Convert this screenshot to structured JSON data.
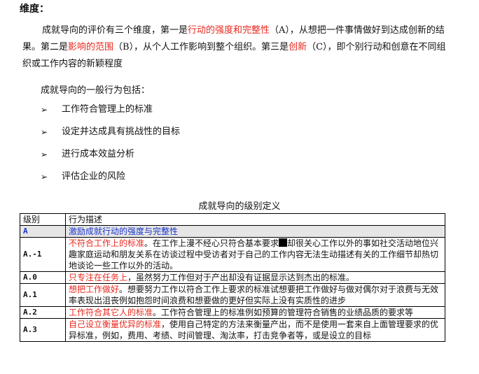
{
  "heading": "维度：",
  "paragraph": {
    "s1": "成就导向的评价有三个维度，第一是",
    "s1_red": "行动的强度和完整性",
    "s2": "（A），从想把一件事情做好到达成创新的结果。第二是",
    "s2_red": "影响的范围",
    "s3": "（B），从个人工作影响到整个组织。第三是",
    "s3_red": "创新",
    "s4": "（C），即个别行动和创意在不同组织或工作内容的新颖程度"
  },
  "intro": "成就导向的一般行为包括：",
  "bullet_glyph": "➢",
  "bullets": [
    "工作符合管理上的标准",
    "设定并达成具有挑战性的目标",
    "进行成本效益分析",
    "评估企业的风险"
  ],
  "table_title": "成就导向的级别定义",
  "table": {
    "headers": [
      "级别",
      "行为描述"
    ],
    "rows": [
      {
        "level": "A",
        "red": "",
        "text": "激励成就行动的强度与完整性"
      },
      {
        "level": "A.-1",
        "red": "不符合工作上的标准",
        "text": "。在工作上漫不经心只符合基本要求",
        "text2": "却很关心工作以外的事如社交活动地位兴趣家庭运动和朋友关系在访谈过程中受访者对于自己的工作内容无法生动描述有关的工作细节却热切地谈论一些工作以外的活动。"
      },
      {
        "level": "A.0",
        "red": "只专注在任务上",
        "text": "，虽然努力工作但对于产出却没有证据显示达到杰出的标准。"
      },
      {
        "level": "A.1",
        "red": "想把工作做好",
        "text": "。想要努力工作以符合工作上要求的标准试想要把工作做好与做对偶尔对于浪费与无效率表现出沮丧例如抱怨时间浪费和想要做的更好但实际上没有实质性的进步"
      },
      {
        "level": "A.2",
        "red": "工作符合其它人的标准",
        "text": "。工作符合管理上的标准例如预算的管理符合销售的业绩品质的要求等"
      },
      {
        "level": "A.3",
        "red": "自己设立衡量优异的标准",
        "text": "，使用自己特定的方法来衡量产出，而不是使用一套来自上面管理要求的优异标准，例如，费用、考绩、时间管理、淘汰率，打击竞争者等，或是设立的目标"
      }
    ]
  }
}
